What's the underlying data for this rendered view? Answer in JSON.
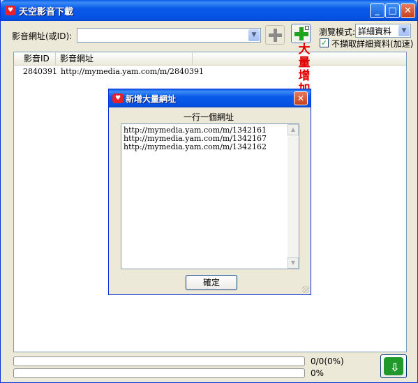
{
  "window": {
    "title": "天空影音下載",
    "icon": "app-logo-icon",
    "controls": [
      "minimize-icon",
      "maximize-icon",
      "close-icon"
    ]
  },
  "toolbar": {
    "url_label": "影音網址(或ID):",
    "url_value": "",
    "browse_mode_label": "瀏覽模式:",
    "browse_mode_value": "詳細資料",
    "skip_details_label": "不擷取詳細資料(加速)",
    "skip_details_checked": true,
    "add_button_icon": "plus-icon",
    "batch_add_button_icon": "plus-list-icon"
  },
  "callout": {
    "text": [
      "大",
      "量",
      "增",
      "加"
    ],
    "color": "#e00000"
  },
  "list": {
    "columns": [
      "影音ID",
      "影音網址"
    ],
    "rows": [
      {
        "id": "2840391",
        "url": "http://mymedia.yam.com/m/2840391"
      }
    ]
  },
  "status": {
    "progress_total": "0/0(0%)",
    "progress_current": "0%",
    "progress_total_value": 0,
    "progress_current_value": 0
  },
  "dialog": {
    "title": "新增大量網址",
    "heading": "一行一個網址",
    "lines": [
      "http://mymedia.yam.com/m/1342161",
      "http://mymedia.yam.com/m/1342167",
      "http://mymedia.yam.com/m/1342162"
    ],
    "ok_label": "確定"
  },
  "colors": {
    "title_bar": "#0a5ae8",
    "window_bg": "#ece9d8",
    "accent_green": "#1ea31e"
  }
}
